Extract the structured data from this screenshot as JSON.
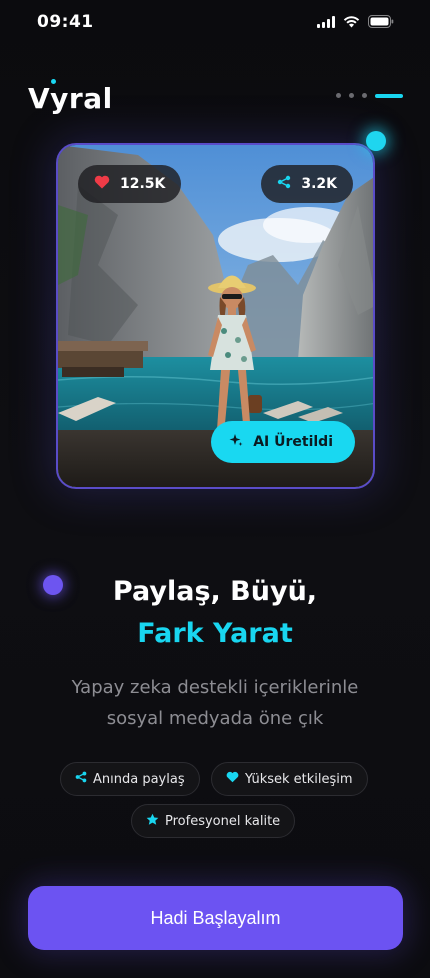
{
  "status_bar": {
    "time": "09:41"
  },
  "header": {
    "logo_text": "Vyral",
    "pager": {
      "total": 4,
      "active": 4
    }
  },
  "hero": {
    "likes": "12.5K",
    "shares": "3.2K",
    "ai_badge": "AI Üretildi"
  },
  "headline": {
    "line1": "Paylaş, Büyü,",
    "line2": "Fark Yarat"
  },
  "subtitle": {
    "line1": "Yapay zeka destekli içeriklerinle",
    "line2": "sosyal medyada öne çık"
  },
  "features": [
    {
      "label": "Anında paylaş",
      "icon": "share-icon"
    },
    {
      "label": "Yüksek etkileşim",
      "icon": "heart-icon"
    },
    {
      "label": "Profesyonel kalite",
      "icon": "star-icon"
    }
  ],
  "cta": {
    "label": "Hadi Başlayalım"
  },
  "colors": {
    "accent": "#19d6f0",
    "primary": "#6c53f2",
    "background": "#0c0c0f",
    "like_red": "#ef3b47"
  }
}
